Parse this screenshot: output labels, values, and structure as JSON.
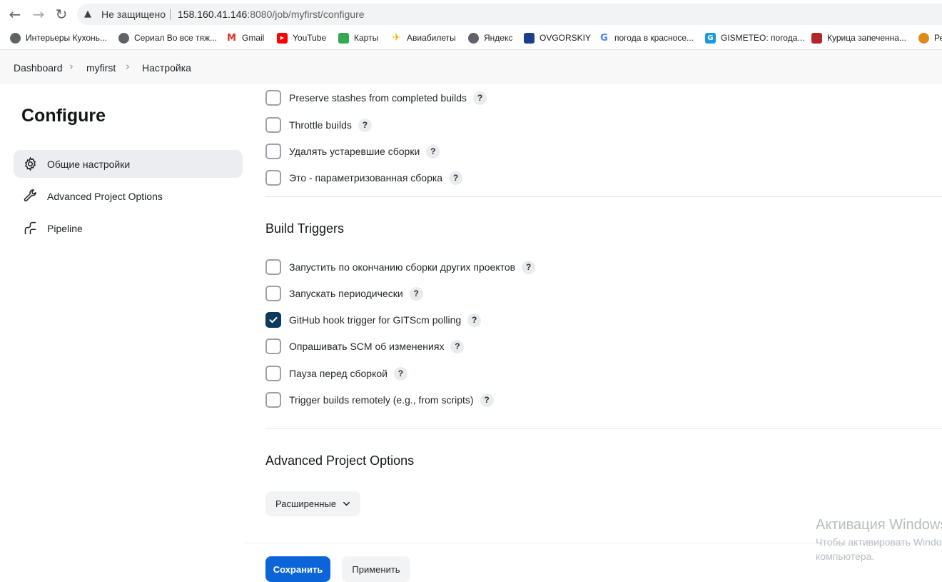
{
  "browser": {
    "not_secure_label": "Не защищено",
    "url_host": "158.160.41.146",
    "url_rest": ":8080/job/myfirst/configure",
    "bookmarks": [
      {
        "label": "Интерьеры Кухонь...",
        "icon": "globe-icon",
        "color": "#5f6368"
      },
      {
        "label": "Сериал Во все тяж...",
        "icon": "globe-icon",
        "color": "#5f6368"
      },
      {
        "label": "Gmail",
        "icon": "gmail-icon",
        "color": "#d93025"
      },
      {
        "label": "YouTube",
        "icon": "youtube-icon",
        "color": "#ff0000"
      },
      {
        "label": "Карты",
        "icon": "maps-icon",
        "color": "#34a853"
      },
      {
        "label": "Авиабилеты",
        "icon": "plane-icon",
        "color": "#f4b400"
      },
      {
        "label": "Яндекс",
        "icon": "globe-icon",
        "color": "#5f6368"
      },
      {
        "label": "OVGORSKIY",
        "icon": "ovgorskiy-icon",
        "color": "#1a3f8f"
      },
      {
        "label": "погода в красносе...",
        "icon": "google-icon",
        "color": "#4285f4"
      },
      {
        "label": "GISMETEO: погода...",
        "icon": "gismeteo-icon",
        "color": "#1a9ae0"
      },
      {
        "label": "Курица запеченна...",
        "icon": "recipe-icon",
        "color": "#b3262c"
      },
      {
        "label": "Ре",
        "icon": "chef-icon",
        "color": "#e08a1a"
      }
    ]
  },
  "breadcrumb": {
    "items": [
      "Dashboard",
      "myfirst",
      "Настройка"
    ]
  },
  "sidebar": {
    "title": "Configure",
    "items": [
      {
        "label": "Общие настройки",
        "icon": "gear-icon"
      },
      {
        "label": "Advanced Project Options",
        "icon": "wrench-icon"
      },
      {
        "label": "Pipeline",
        "icon": "pipeline-icon"
      }
    ]
  },
  "general": {
    "options": [
      {
        "label": "Preserve stashes from completed builds",
        "checked": false
      },
      {
        "label": "Throttle builds",
        "checked": false
      },
      {
        "label": "Удалять устаревшие сборки",
        "checked": false
      },
      {
        "label": "Это - параметризованная сборка",
        "checked": false
      }
    ]
  },
  "build_triggers": {
    "title": "Build Triggers",
    "options": [
      {
        "label": "Запустить по окончанию сборки других проектов",
        "checked": false
      },
      {
        "label": "Запускать периодически",
        "checked": false
      },
      {
        "label": "GitHub hook trigger for GITScm polling",
        "checked": true
      },
      {
        "label": "Опрашивать SCM об изменениях",
        "checked": false
      },
      {
        "label": "Пауза перед сборкой",
        "checked": false
      },
      {
        "label": "Trigger builds remotely (e.g., from scripts)",
        "checked": false
      }
    ]
  },
  "advanced": {
    "title": "Advanced Project Options",
    "button_label": "Расширенные"
  },
  "actions": {
    "save_label": "Сохранить",
    "apply_label": "Применить"
  },
  "help_label": "?",
  "watermark": {
    "line1": "Активация Windows",
    "line2": "Чтобы активировать Windows",
    "line3": "компьютера."
  }
}
